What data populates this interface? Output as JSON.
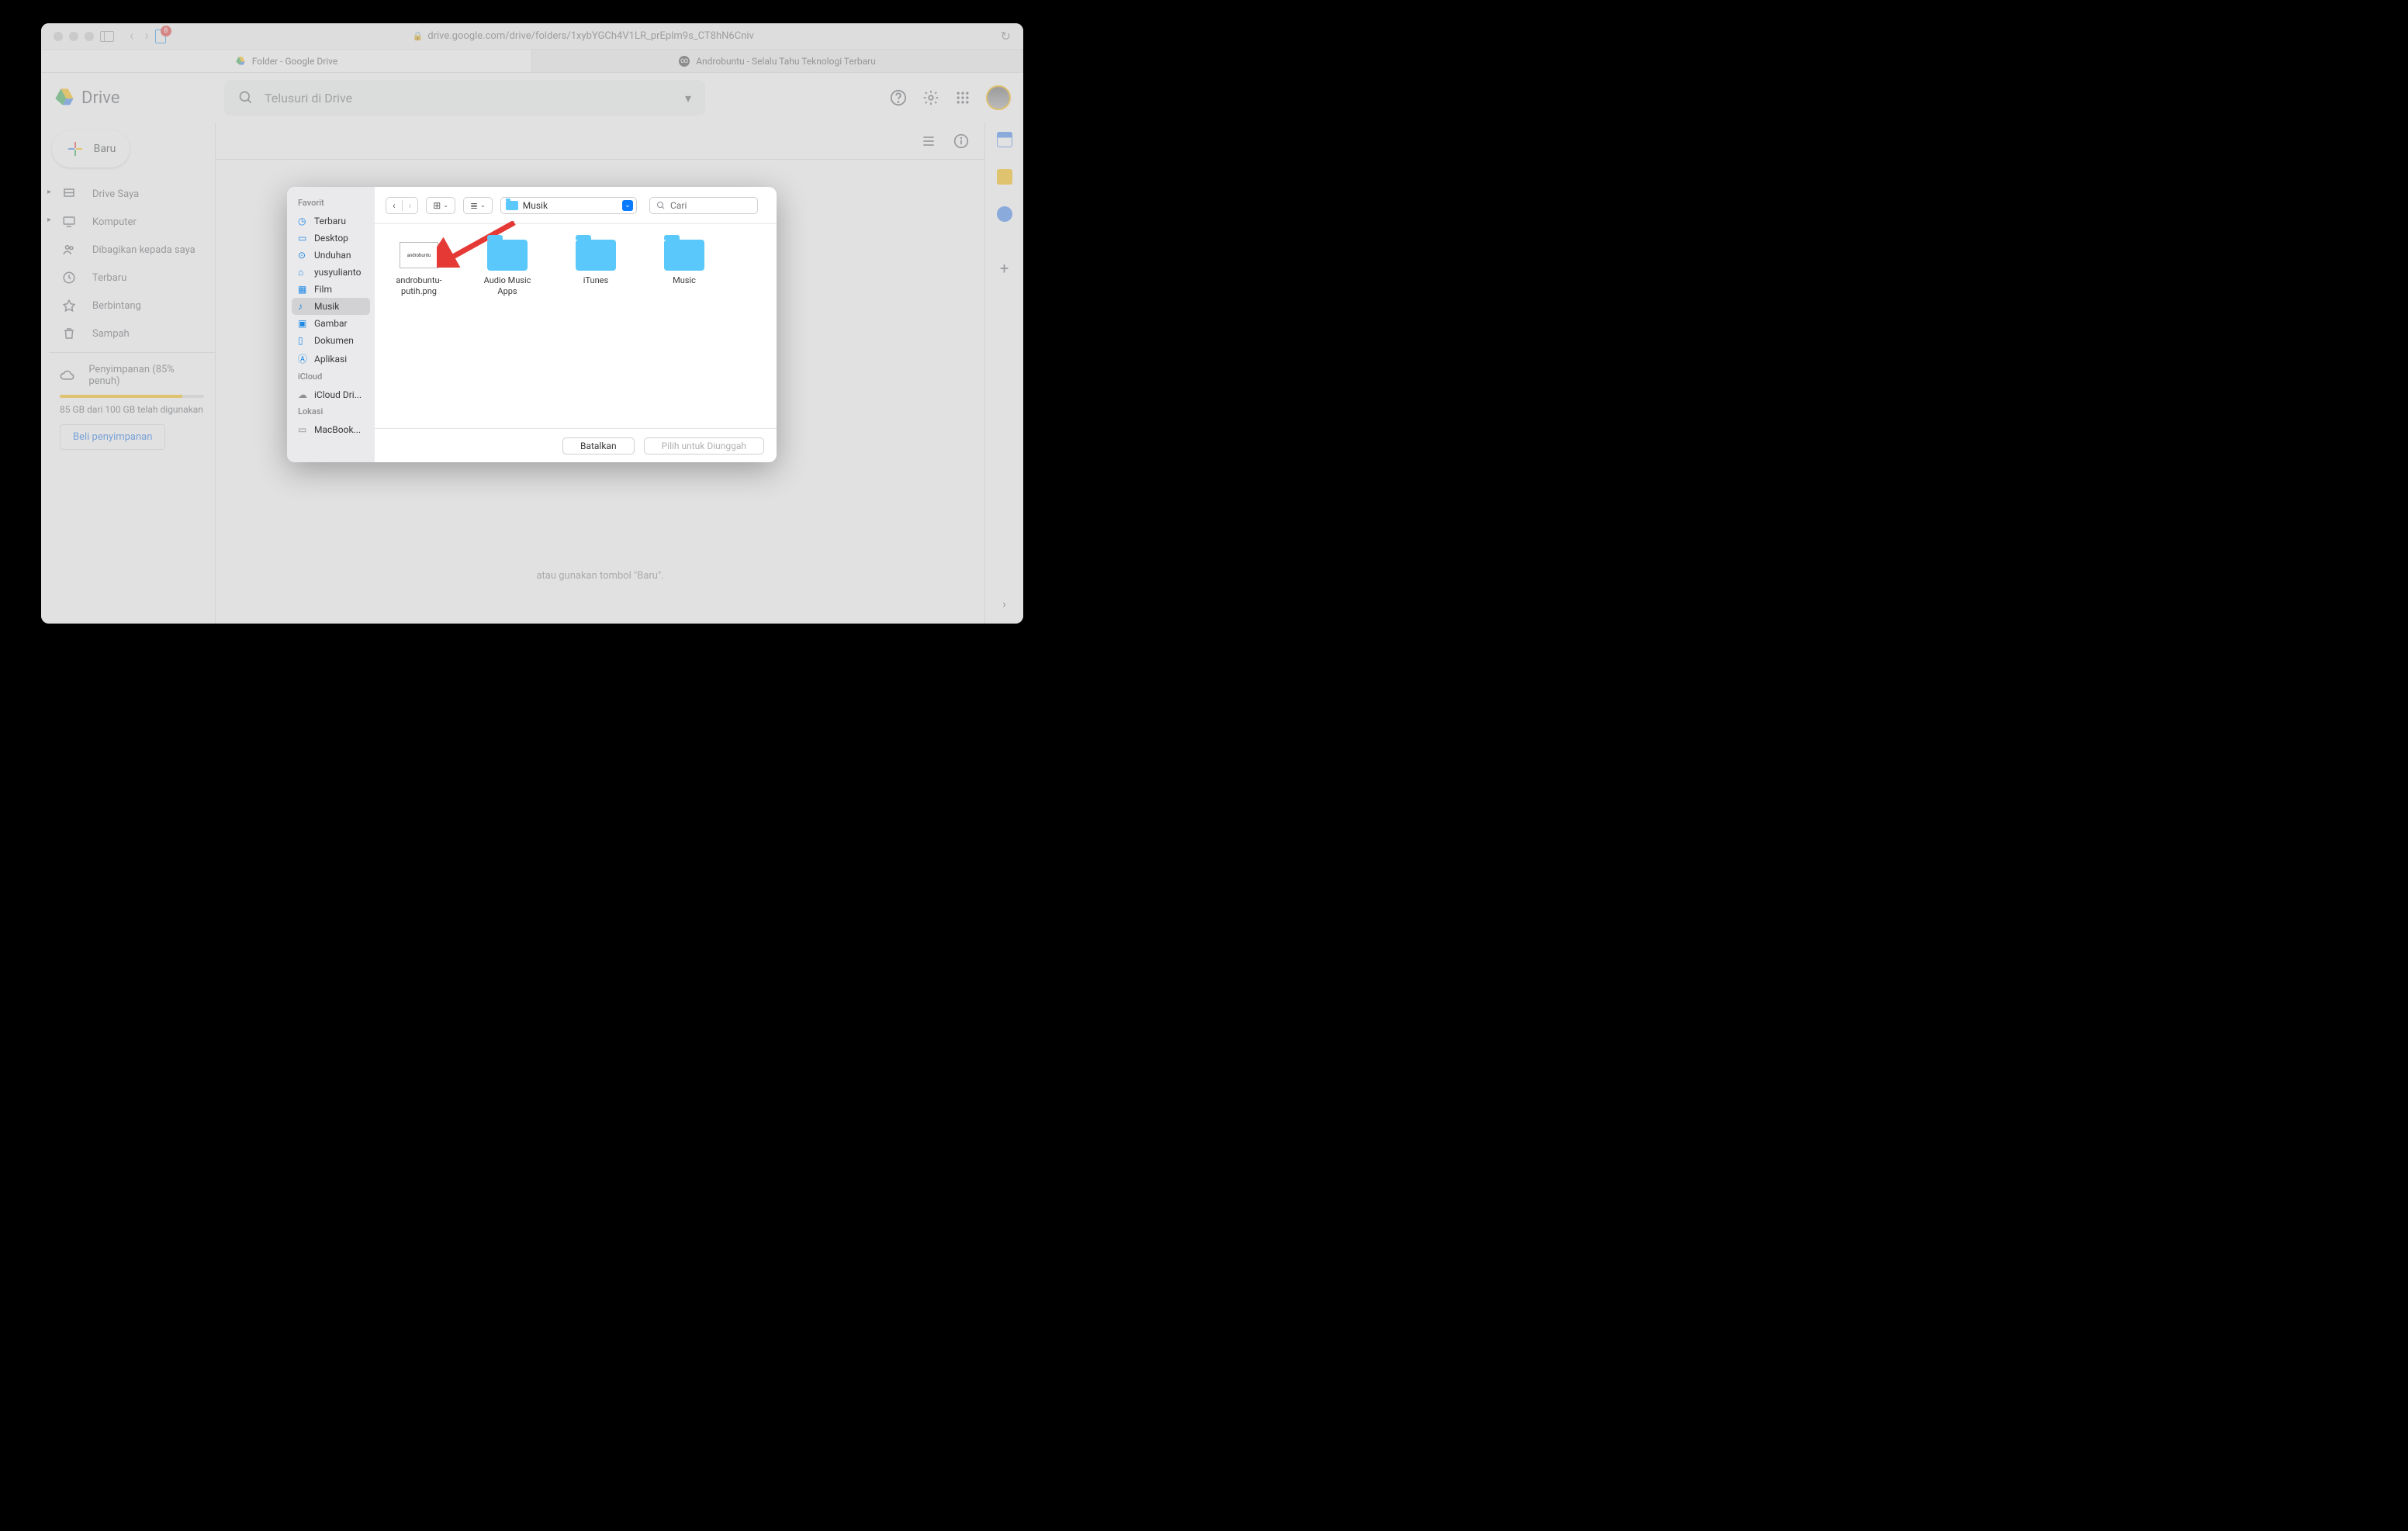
{
  "browser": {
    "tab_badge": "8",
    "url": "drive.google.com/drive/folders/1xybYGCh4V1LR_prEplm9s_CT8hN6Cniv",
    "tabs": [
      {
        "label": "Folder - Google Drive"
      },
      {
        "label": "Androbuntu - Selalu Tahu Teknologi Terbaru"
      }
    ]
  },
  "drive": {
    "app_name": "Drive",
    "search_placeholder": "Telusuri di Drive",
    "new_button": "Baru",
    "sidebar": [
      {
        "label": "Drive Saya",
        "expandable": true
      },
      {
        "label": "Komputer",
        "expandable": true
      },
      {
        "label": "Dibagikan kepada saya"
      },
      {
        "label": "Terbaru"
      },
      {
        "label": "Berbintang"
      },
      {
        "label": "Sampah"
      }
    ],
    "storage": {
      "label": "Penyimpanan (85% penuh)",
      "detail": "85 GB dari 100 GB telah digunakan",
      "buy": "Beli penyimpanan"
    },
    "hint": "atau gunakan tombol \"Baru\"."
  },
  "finder": {
    "sections": {
      "favorites_header": "Favorit",
      "icloud_header": "iCloud",
      "locations_header": "Lokasi"
    },
    "sidebar": {
      "favorites": [
        "Terbaru",
        "Desktop",
        "Unduhan",
        "yusyulianto",
        "Film",
        "Musik",
        "Gambar",
        "Dokumen",
        "Aplikasi"
      ],
      "icloud": [
        "iCloud Dri..."
      ],
      "locations": [
        "MacBook..."
      ]
    },
    "selected_sidebar": "Musik",
    "path_name": "Musik",
    "search_placeholder": "Cari",
    "items": [
      {
        "name": "androbuntu-putih.png",
        "type": "file",
        "thumb_text": "androbuntu"
      },
      {
        "name": "Audio Music Apps",
        "type": "folder"
      },
      {
        "name": "iTunes",
        "type": "folder"
      },
      {
        "name": "Music",
        "type": "folder"
      }
    ],
    "buttons": {
      "cancel": "Batalkan",
      "upload": "Pilih untuk Diunggah"
    }
  }
}
